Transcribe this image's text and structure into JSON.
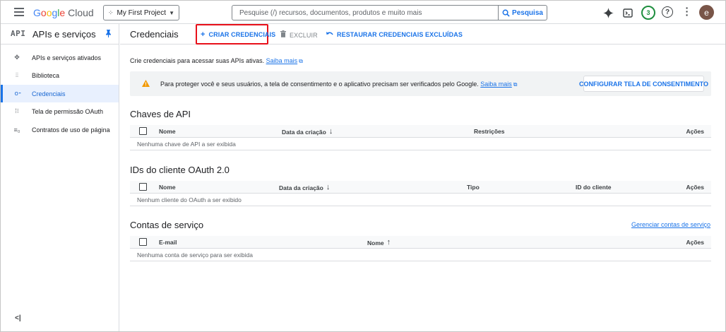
{
  "header": {
    "logo_google": "Google",
    "logo_cloud": "Cloud",
    "project": "My First Project",
    "search_placeholder": "Pesquise (/) recursos, documentos, produtos e muito mais",
    "search_button": "Pesquisa",
    "notifications_count": "3",
    "avatar_letter": "e"
  },
  "sidebar": {
    "api_mark": "API",
    "title": "APIs e serviços",
    "items": [
      {
        "label": "APIs e serviços ativados",
        "icon": "apis-icon"
      },
      {
        "label": "Biblioteca",
        "icon": "library-icon"
      },
      {
        "label": "Credenciais",
        "icon": "key-icon",
        "active": true
      },
      {
        "label": "Tela de permissão OAuth",
        "icon": "oauth-icon"
      },
      {
        "label": "Contratos de uso de página",
        "icon": "settings-list-icon"
      }
    ],
    "collapse": "<|"
  },
  "toolbar": {
    "title": "Credenciais",
    "create": "CRIAR CREDENCIAIS",
    "delete": "EXCLUIR",
    "restore": "RESTAURAR CREDENCIAIS EXCLUÍDAS"
  },
  "intro": {
    "text": "Crie credenciais para acessar suas APIs ativas.",
    "link": "Saiba mais"
  },
  "alert": {
    "text": "Para proteger você e seus usuários, a tela de consentimento e o aplicativo precisam ser verificados pelo Google.",
    "link": "Saiba mais",
    "button": "CONFIGURAR TELA DE CONSENTIMENTO"
  },
  "api_keys": {
    "title": "Chaves de API",
    "columns": [
      "Nome",
      "Data da criação",
      "Restrições",
      "Ações"
    ],
    "empty": "Nenhuma chave de API a ser exibida"
  },
  "oauth": {
    "title": "IDs do cliente OAuth 2.0",
    "columns": [
      "Nome",
      "Data da criação",
      "Tipo",
      "ID do cliente",
      "Ações"
    ],
    "empty": "Nenhum cliente do OAuth a ser exibido"
  },
  "service_accounts": {
    "title": "Contas de serviço",
    "manage": "Gerenciar contas de serviço",
    "columns": [
      "E-mail",
      "Nome",
      "Ações"
    ],
    "empty": "Nenhuma conta de serviço para ser exibida"
  },
  "colors": {
    "accent": "#1a73e8",
    "highlight": "#e8101a",
    "warning": "#f29900"
  }
}
